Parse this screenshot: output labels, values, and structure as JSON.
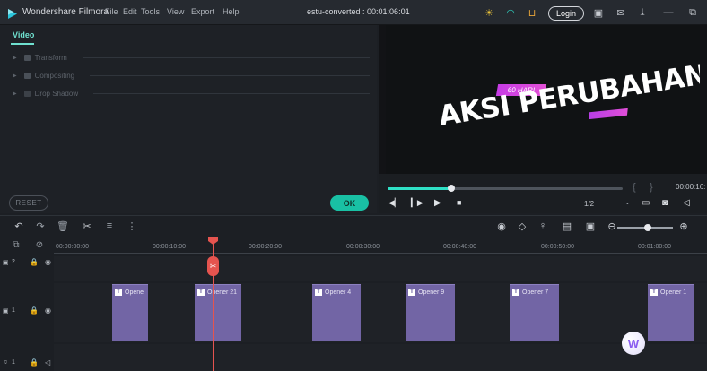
{
  "app": {
    "name": "Wondershare Filmora",
    "project_title": "estu-converted : 00:01:06:01",
    "menu": [
      "File",
      "Edit",
      "Tools",
      "View",
      "Export",
      "Help"
    ],
    "login_label": "Login"
  },
  "left_panel": {
    "tab": "Video",
    "sections": [
      "Transform",
      "Compositing",
      "Drop Shadow"
    ],
    "reset_label": "RESET",
    "ok_label": "OK"
  },
  "preview": {
    "badge_text": "60 HARI",
    "title_text": "AKSI PERUBAHAN",
    "time": "00:00:16:",
    "ratio": "1/2",
    "progress": 0.27
  },
  "timeline": {
    "ruler_labels": [
      "00:00:00:00",
      "00:00:10:00",
      "00:00:20:00",
      "00:00:30:00",
      "00:00:40:00",
      "00:00:50:00",
      "00:01:00:00"
    ],
    "track_labels": [
      "2",
      "1",
      "1"
    ],
    "clips": [
      {
        "label": "Opene"
      },
      {
        "label": "Opener 21"
      },
      {
        "label": "Opener 4"
      },
      {
        "label": "Opener 9"
      },
      {
        "label": "Opener 7"
      },
      {
        "label": "Opener 1"
      }
    ],
    "zoom_level": 0.55
  },
  "icons": {
    "app_logo": "filmora-logo-icon",
    "watermark": "wondershare-logo-icon"
  },
  "colors": {
    "accent": "#19c0a4",
    "playhead": "#e5544f",
    "clip": "#7265a5"
  }
}
